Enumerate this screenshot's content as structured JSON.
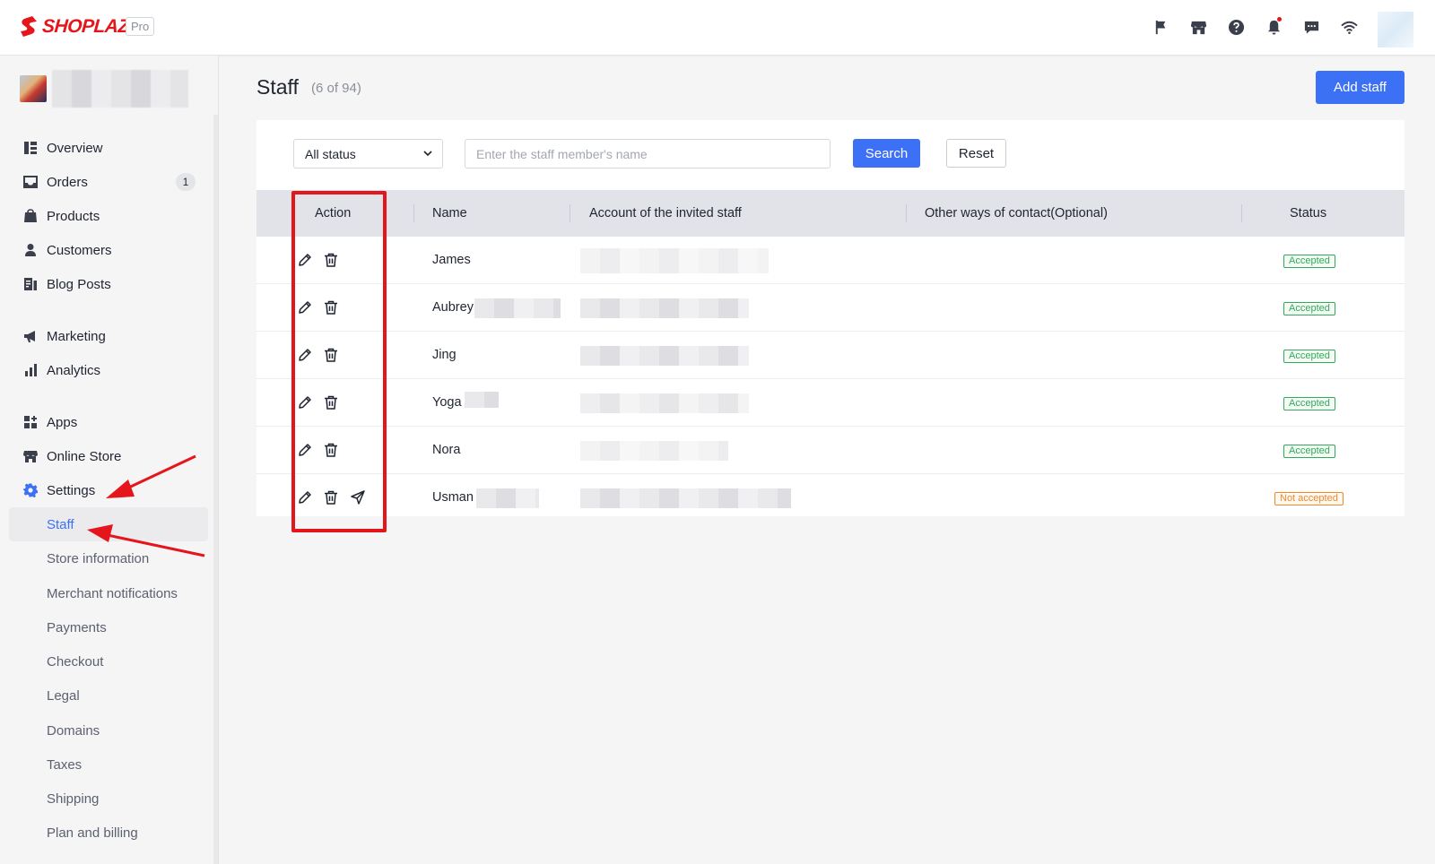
{
  "app": {
    "brand": "SHOPLAZZA",
    "plan": "Pro"
  },
  "topbar": {
    "icons": [
      "flag-icon",
      "store-icon",
      "help-icon",
      "bell-icon",
      "chat-icon",
      "wifi-icon"
    ]
  },
  "sidebar": {
    "items": [
      {
        "label": "Overview",
        "icon": "overview-icon"
      },
      {
        "label": "Orders",
        "icon": "orders-icon",
        "badge": "1"
      },
      {
        "label": "Products",
        "icon": "products-icon"
      },
      {
        "label": "Customers",
        "icon": "customers-icon"
      },
      {
        "label": "Blog Posts",
        "icon": "blog-icon"
      },
      {
        "label": "Marketing",
        "icon": "megaphone-icon"
      },
      {
        "label": "Analytics",
        "icon": "analytics-icon"
      },
      {
        "label": "Apps",
        "icon": "apps-icon"
      },
      {
        "label": "Online Store",
        "icon": "store-icon"
      },
      {
        "label": "Settings",
        "icon": "gear-icon"
      }
    ],
    "settings_sub": [
      "Staff",
      "Store information",
      "Merchant notifications",
      "Payments",
      "Checkout",
      "Legal",
      "Domains",
      "Taxes",
      "Shipping",
      "Plan and billing"
    ]
  },
  "page": {
    "title": "Staff",
    "count": "(6 of 94)",
    "add_button": "Add staff"
  },
  "filters": {
    "status_selected": "All status",
    "search_placeholder": "Enter the staff member's name",
    "search_button": "Search",
    "reset_button": "Reset"
  },
  "table": {
    "headers": {
      "action": "Action",
      "name": "Name",
      "account": "Account of the invited staff",
      "contact": "Other ways of contact(Optional)",
      "status": "Status"
    },
    "rows": [
      {
        "name": "James",
        "status": "Accepted"
      },
      {
        "name": "Aubrey",
        "status": "Accepted"
      },
      {
        "name": "Jing",
        "status": "Accepted"
      },
      {
        "name": "Yoga",
        "status": "Accepted"
      },
      {
        "name": "Nora",
        "status": "Accepted"
      },
      {
        "name": "Usman",
        "status": "Not accepted"
      }
    ]
  },
  "colors": {
    "brand": "#e5161b",
    "primary": "#3c70f5",
    "accepted": "#35a85b",
    "not_accepted": "#f0892a"
  }
}
